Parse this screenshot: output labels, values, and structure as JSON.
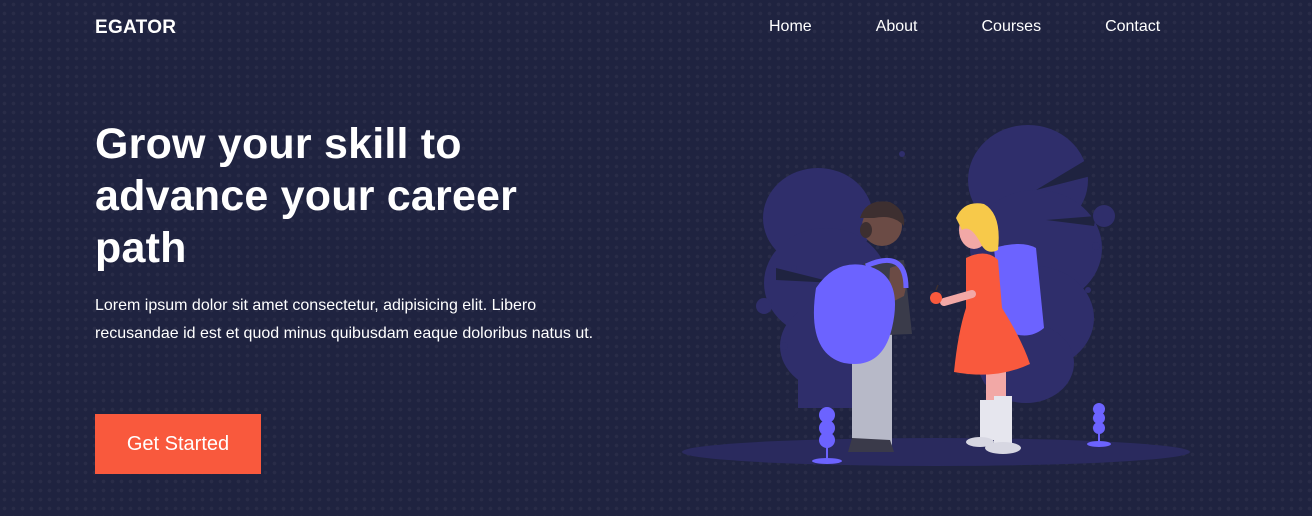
{
  "navbar": {
    "brand": "EGATOR",
    "links": [
      {
        "label": "Home"
      },
      {
        "label": "About"
      },
      {
        "label": "Courses"
      },
      {
        "label": "Contact"
      }
    ]
  },
  "hero": {
    "title": "Grow your skill to advance your career path",
    "text": "Lorem ipsum dolor sit amet consectetur, adipisicing elit. Libero recusandae id est et quod minus quibusdam eaque doloribus natus ut.",
    "cta_label": "Get Started"
  },
  "colors": {
    "background": "#1f2340",
    "accent": "#f9593d",
    "illustration_purple": "#6c63ff",
    "blob": "#2f2e6b"
  },
  "illustration": {
    "icon": "students-with-backpacks-illustration"
  }
}
